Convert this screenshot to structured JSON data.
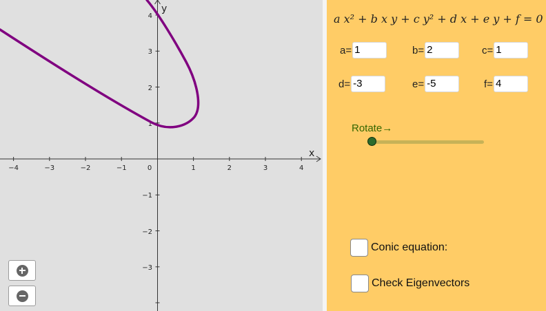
{
  "graph": {
    "x_axis_name": "x",
    "y_axis_name": "y",
    "x_tick_labels": [
      "−4",
      "−3",
      "−2",
      "−1",
      "0",
      "1",
      "2",
      "3",
      "4"
    ],
    "y_tick_labels": [
      "4",
      "3",
      "2",
      "1",
      "−1",
      "−2",
      "−3"
    ],
    "curve_color": "#800080",
    "background_color": "#e0e0e0"
  },
  "zoom": {
    "zoom_in_icon": "plus-circle-icon",
    "zoom_out_icon": "minus-circle-icon"
  },
  "panel": {
    "background_color": "#ffcc66",
    "equation": "a x² + b x y + c y² + d x + e y + f = 0",
    "coefficients": [
      {
        "label": "a=",
        "value": "1"
      },
      {
        "label": "b=",
        "value": "2"
      },
      {
        "label": "c=",
        "value": "1"
      },
      {
        "label": "d=",
        "value": "-3"
      },
      {
        "label": "e=",
        "value": "-5"
      },
      {
        "label": "f=",
        "value": "4"
      }
    ],
    "rotate_label": "Rotate→",
    "rotate_slider_value": 0,
    "checkbox_conic": "Conic equation:",
    "checkbox_eigen": "Check Eigenvectors"
  }
}
